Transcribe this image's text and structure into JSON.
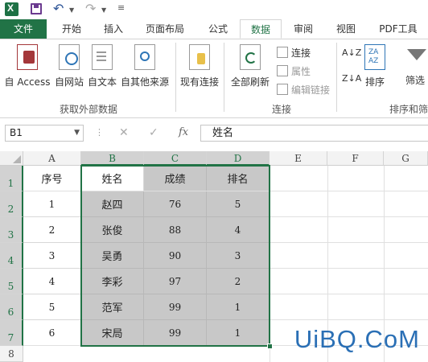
{
  "ribbon_tabs": [
    "文件",
    "开始",
    "插入",
    "页面布局",
    "公式",
    "数据",
    "审阅",
    "视图",
    "PDF工具"
  ],
  "active_tab": "数据",
  "ribbon": {
    "external_data": {
      "buttons": [
        "自 Access",
        "自网站",
        "自文本",
        "自其他来源"
      ],
      "existing_conn": "现有连接",
      "label": "获取外部数据"
    },
    "connections": {
      "refresh_all": "全部刷新",
      "connections": "连接",
      "properties": "属性",
      "edit_links": "编辑链接",
      "label": "连接"
    },
    "sort_filter": {
      "sort": "排序",
      "filter": "筛选",
      "label": "排序和筛"
    }
  },
  "formula_bar": {
    "name_box": "B1",
    "fx": "fx",
    "content": "姓名"
  },
  "columns": [
    "A",
    "B",
    "C",
    "D",
    "E",
    "F",
    "G"
  ],
  "rows": [
    "1",
    "2",
    "3",
    "4",
    "5",
    "6",
    "7",
    "8"
  ],
  "table": {
    "headers": [
      "序号",
      "姓名",
      "成绩",
      "排名"
    ],
    "rows": [
      [
        "1",
        "赵四",
        "76",
        "5"
      ],
      [
        "2",
        "张俊",
        "88",
        "4"
      ],
      [
        "3",
        "吴勇",
        "90",
        "3"
      ],
      [
        "4",
        "李彩",
        "97",
        "2"
      ],
      [
        "5",
        "范军",
        "99",
        "1"
      ],
      [
        "6",
        "宋局",
        "99",
        "1"
      ]
    ]
  },
  "watermark": "UiBQ.CoM",
  "colors": {
    "excel_green": "#217346",
    "selection_gray": "#c8c8c8",
    "watermark_blue": "#2a6fb5"
  },
  "icons": [
    "excel-icon",
    "save-icon",
    "undo-icon",
    "redo-icon",
    "cancel-icon",
    "enter-icon"
  ]
}
